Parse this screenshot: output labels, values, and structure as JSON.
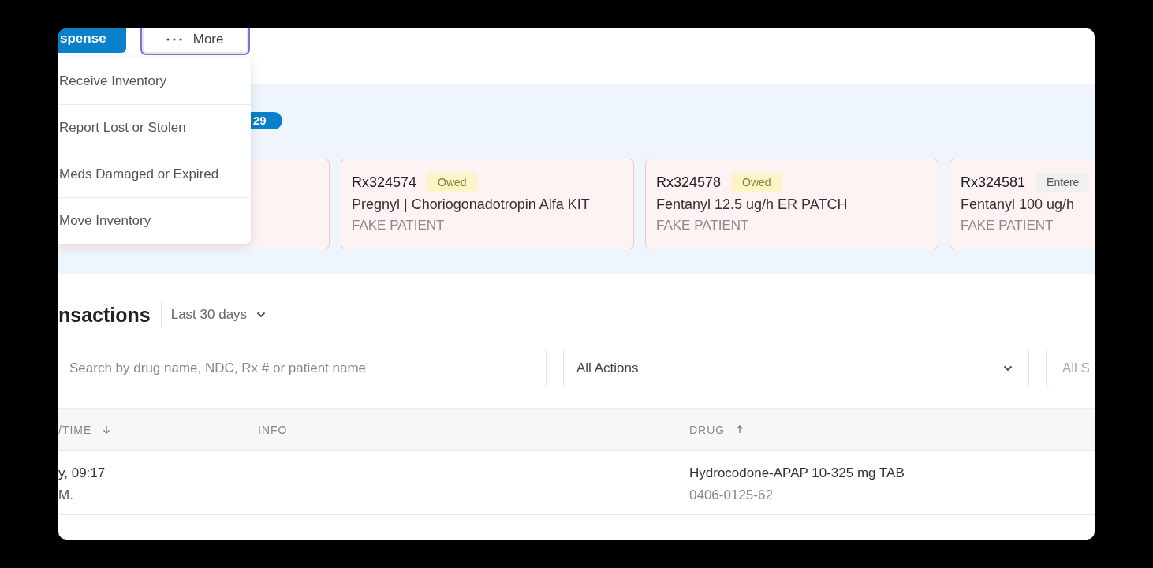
{
  "toolbar": {
    "buttons": [
      {
        "label": "spense",
        "kind": "primary"
      },
      {
        "label": "More",
        "kind": "more"
      }
    ]
  },
  "menu": {
    "items": [
      "Receive Inventory",
      "Report Lost or Stolen",
      "Meds Damaged or Expired",
      "Move Inventory"
    ]
  },
  "alerts": {
    "count": "29",
    "cards": [
      {
        "kind": "covered"
      },
      {
        "kind": "prescription",
        "rx": "Rx324574",
        "status": {
          "label": "Owed",
          "kind": "owed"
        },
        "drug": "Pregnyl | Choriogonadotropin Alfa KIT",
        "patient": "FAKE PATIENT"
      },
      {
        "kind": "prescription",
        "rx": "Rx324578",
        "status": {
          "label": "Owed",
          "kind": "owed"
        },
        "drug": "Fentanyl 12.5 ug/h ER PATCH",
        "patient": "FAKE PATIENT"
      },
      {
        "kind": "prescription",
        "rx": "Rx324581",
        "status": {
          "label": "Entere",
          "kind": "entered"
        },
        "drug": "Fentanyl 100 ug/h",
        "patient": "FAKE PATIENT"
      }
    ]
  },
  "transactions": {
    "title": "nsactions",
    "period": "Last 30 days",
    "search": {
      "placeholder": "Search by drug name, NDC, Rx # or patient name"
    },
    "filters": [
      {
        "value": "All Actions",
        "kind": "value"
      },
      {
        "value": "All S",
        "kind": "placeholder"
      }
    ],
    "table": {
      "columns": [
        {
          "label": "/TIME",
          "kind": "sorted_desc"
        },
        {
          "label": "INFO",
          "kind": "plain"
        },
        {
          "label": "DRUG",
          "kind": "sorted_asc"
        }
      ],
      "rows": [
        {
          "date": "y, 09:17",
          "user": "M.",
          "drug": "Hydrocodone-APAP 10-325 mg TAB",
          "ndc": "0406-0125-62"
        }
      ]
    }
  }
}
